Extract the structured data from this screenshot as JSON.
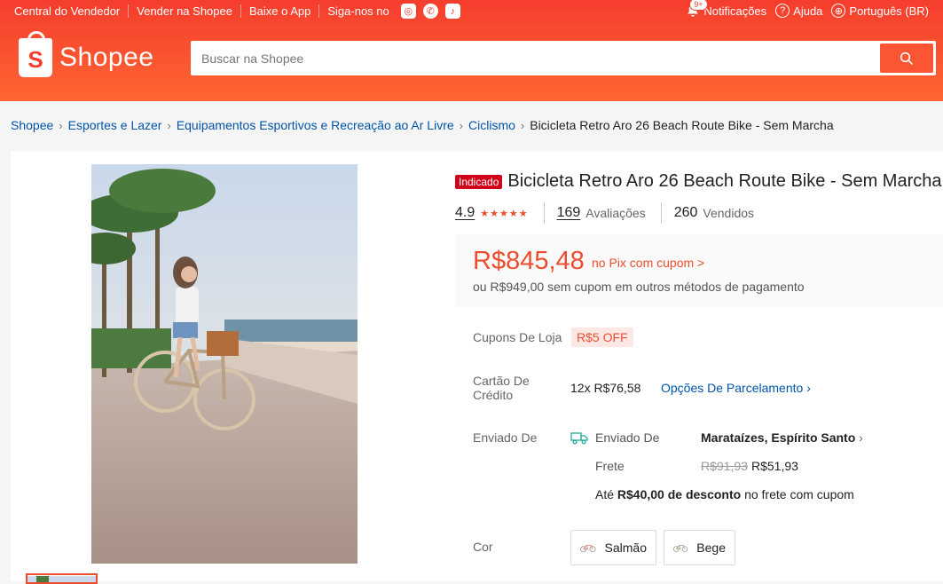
{
  "topbar": {
    "links": [
      "Central do Vendedor",
      "Vender na Shopee",
      "Baixe o App",
      "Siga-nos no"
    ],
    "notification_badge": "9+",
    "notifications": "Notificações",
    "help": "Ajuda",
    "language": "Português (BR)"
  },
  "brand": {
    "name": "Shopee",
    "bag_letter": "S"
  },
  "search": {
    "placeholder": "Buscar na Shopee"
  },
  "breadcrumb": [
    "Shopee",
    "Esportes e Lazer",
    "Equipamentos Esportivos e Recreação ao Ar Livre",
    "Ciclismo",
    "Bicicleta Retro Aro 26 Beach Route Bike - Sem Marcha"
  ],
  "product": {
    "tag": "Indicado",
    "title": "Bicicleta Retro Aro 26 Beach Route Bike - Sem Marcha",
    "rating": "4.9",
    "stars": "★★★★★",
    "reviews_count": "169",
    "reviews_label": "Avaliações",
    "sold_count": "260",
    "sold_label": "Vendidos",
    "price": "R$845,48",
    "pix_label": "no Pix com cupom >",
    "alt_price": "ou R$949,00 sem cupom em outros métodos de pagamento",
    "coupons_label": "Cupons De Loja",
    "coupon": "R$5 OFF",
    "card_label_1": "Cartão De",
    "card_label_2": "Crédito",
    "installments": "12x R$76,58",
    "installment_options": "Opções De Parcelamento ›",
    "shipped_label": "Enviado De",
    "shipped_from_label": "Enviado De",
    "ship_location": "Marataízes, Espírito Santo",
    "ship_chevron": "›",
    "freight_label": "Frete",
    "freight_old": "R$91,93",
    "freight_new": "R$51,93",
    "discount_prefix": "Até",
    "discount_value": "R$40,00 de desconto",
    "discount_suffix": "no frete com cupom",
    "color_label": "Cor",
    "variants": [
      "Salmão",
      "Bege"
    ]
  },
  "colors": {
    "brand": "#ee4d2d",
    "link": "#0055aa"
  }
}
